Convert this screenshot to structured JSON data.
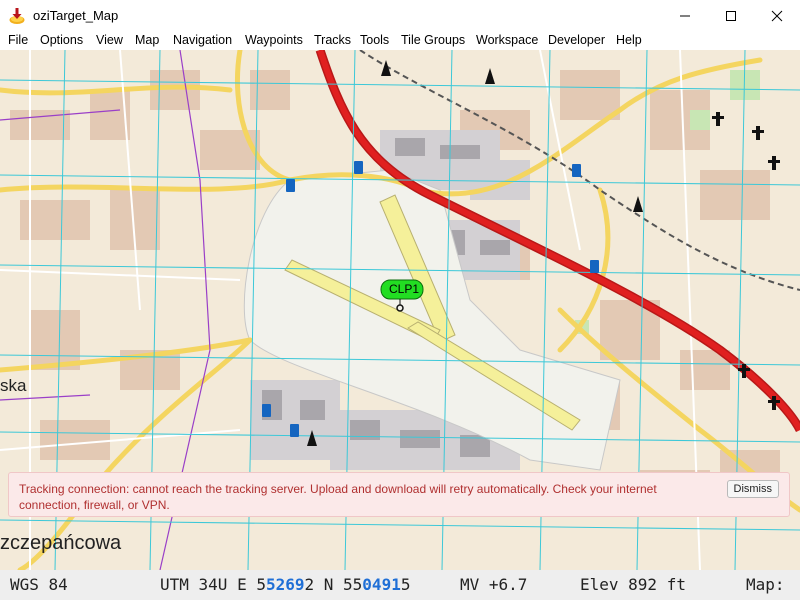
{
  "window": {
    "title": "oziTarget_Map"
  },
  "menu": [
    "File",
    "Options",
    "View",
    "Map",
    "Navigation",
    "Waypoints",
    "Tracks",
    "Tools",
    "Tile Groups",
    "Workspace",
    "Developer",
    "Help"
  ],
  "map": {
    "waypoint_label": "CLP1",
    "place_label_left": "ska",
    "place_label_bottom": "zczepańcowa"
  },
  "banner": {
    "message": "Tracking connection: cannot reach the tracking server. Upload and download will retry automatically. Check your internet connection, firewall, or VPN.",
    "dismiss_label": "Dismiss"
  },
  "status": {
    "datum": "WGS 84",
    "utm_prefix": "UTM 34U E 5",
    "easting_hi": "5269",
    "easting_tail": "2 N 55",
    "northing_hi": "0491",
    "northing_tail": "5",
    "mv": "MV +6.7",
    "elev": "Elev 892 ft",
    "map_label": "Map:"
  },
  "colors": {
    "accent": "#1f6fd6",
    "error_text": "#b03030",
    "error_bg": "#fbe9e9",
    "road_major": "#e02020",
    "grid": "#3cc8d8"
  }
}
